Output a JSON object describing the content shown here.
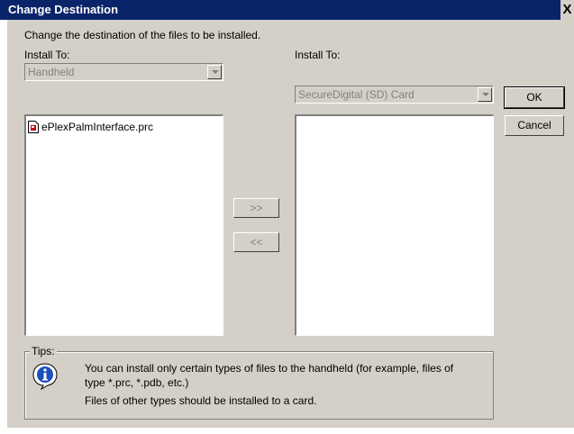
{
  "window": {
    "title": "Change Destination",
    "close_label": "X"
  },
  "intro_text": "Change the destination of the files to be installed.",
  "left_panel": {
    "label": "Install To:",
    "selected": "Handheld",
    "files": [
      {
        "name": "ePlexPalmInterface.prc",
        "icon": "palm-prc-file-icon"
      }
    ]
  },
  "right_panel": {
    "label": "Install To:",
    "selected": "SecureDigital (SD) Card",
    "files": []
  },
  "buttons": {
    "move_right": ">>",
    "move_left": "<<",
    "ok": "OK",
    "cancel": "Cancel"
  },
  "tips": {
    "title": "Tips:",
    "icon": "info-icon",
    "line1": "You can install only certain types of files to the handheld (for example, files of",
    "line2": "type *.prc, *.pdb, etc.)",
    "line3": "Files of other types should be installed to a card."
  },
  "colors": {
    "titlebar": "#0a246a",
    "dialog_bg": "#d4d0c8",
    "info_blue": "#1c4fbf"
  }
}
